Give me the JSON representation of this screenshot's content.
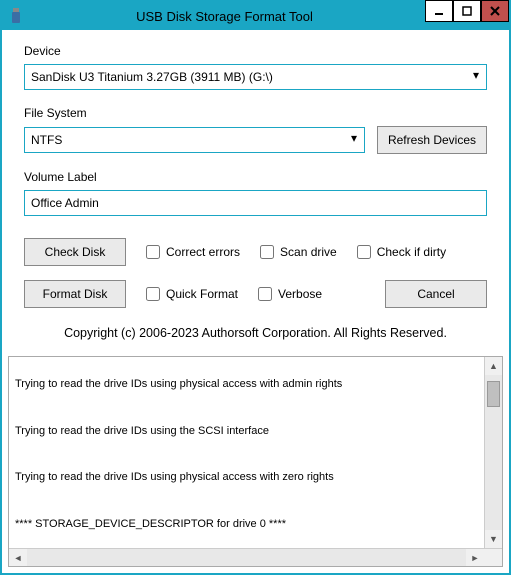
{
  "window": {
    "title": "USB Disk Storage Format Tool"
  },
  "labels": {
    "device": "Device",
    "filesystem": "File System",
    "volume_label": "Volume Label"
  },
  "device": {
    "selected": "SanDisk U3 Titanium 3.27GB (3911 MB)  (G:\\)"
  },
  "filesystem": {
    "selected": "NTFS"
  },
  "volume_label": {
    "value": "Office Admin"
  },
  "buttons": {
    "refresh": "Refresh Devices",
    "check_disk": "Check Disk",
    "format_disk": "Format Disk",
    "cancel": "Cancel"
  },
  "checkboxes": {
    "correct_errors": "Correct errors",
    "scan_drive": "Scan drive",
    "check_if_dirty": "Check if dirty",
    "quick_format": "Quick Format",
    "verbose": "Verbose"
  },
  "copyright": "Copyright (c) 2006-2023 Authorsoft Corporation. All Rights Reserved.",
  "log": {
    "lines": [
      "Trying to read the drive IDs using physical access with admin rights",
      "Trying to read the drive IDs using the SCSI interface",
      "Trying to read the drive IDs using physical access with zero rights",
      "**** STORAGE_DEVICE_DESCRIPTOR for drive 0 ****"
    ]
  }
}
